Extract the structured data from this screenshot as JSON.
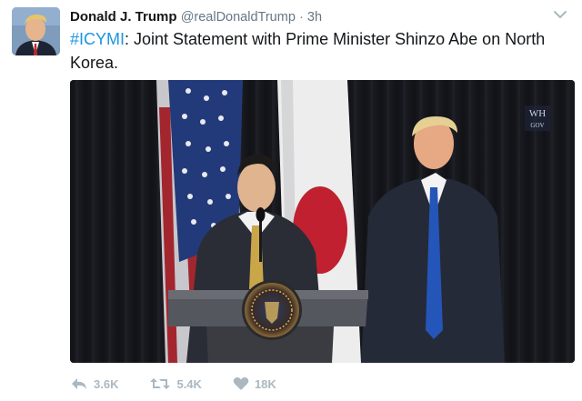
{
  "tweet": {
    "author": {
      "name": "Donald J. Trump",
      "handle": "@realDonaldTrump",
      "separator": "·",
      "time": "3h"
    },
    "text": {
      "hashtag": "#ICYMI",
      "body": ": Joint Statement with Prime Minister Shinzo Abe on North Korea."
    },
    "media": {
      "watermark_line1": "WH",
      "watermark_line2": "GOV"
    },
    "actions": {
      "reply_count": "3.6K",
      "retweet_count": "5.4K",
      "like_count": "18K"
    },
    "icons": {
      "avatar": "profile-photo",
      "caret": "chevron-down-icon",
      "reply": "reply-icon",
      "retweet": "retweet-icon",
      "like": "heart-icon"
    },
    "colors": {
      "hashtag": "#1b95e0",
      "muted": "#657786",
      "action_gray": "#aab8c2"
    }
  }
}
